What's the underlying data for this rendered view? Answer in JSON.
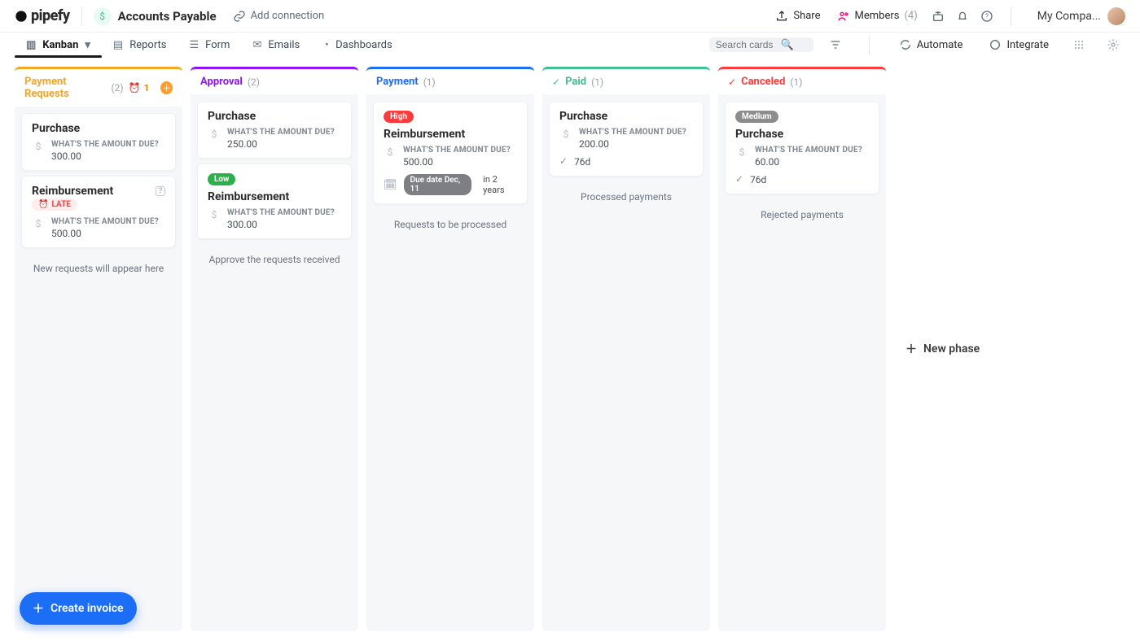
{
  "header": {
    "logo": "pipefy",
    "pipe_name": "Accounts Payable",
    "add_connection": "Add connection",
    "share": "Share",
    "members": "Members",
    "members_count": "(4)",
    "company": "My Compa...",
    "search_placeholder": "Search cards"
  },
  "tabs": {
    "kanban": "Kanban",
    "reports": "Reports",
    "form": "Form",
    "emails": "Emails",
    "dashboards": "Dashboards",
    "automate": "Automate",
    "integrate": "Integrate"
  },
  "columns": {
    "payment_requests": {
      "name": "Payment Requests",
      "count": "(2)",
      "alarm": "1",
      "footer": "New requests will appear here"
    },
    "approval": {
      "name": "Approval",
      "count": "(2)",
      "footer": "Approve the requests received"
    },
    "payment": {
      "name": "Payment",
      "count": "(1)",
      "footer": "Requests to be processed"
    },
    "paid": {
      "name": "Paid",
      "count": "(1)",
      "footer": "Processed payments"
    },
    "canceled": {
      "name": "Canceled",
      "count": "(1)",
      "footer": "Rejected payments"
    }
  },
  "labels": {
    "amount_due": "WHAT'S THE AMOUNT DUE?",
    "late": "LATE",
    "high": "High",
    "low": "Low",
    "medium": "Medium",
    "new_phase": "New phase",
    "create_invoice": "Create invoice"
  },
  "cards": {
    "pr1": {
      "title": "Purchase",
      "amount": "300.00"
    },
    "pr2": {
      "title": "Reimbursement",
      "amount": "500.00"
    },
    "ap1": {
      "title": "Purchase",
      "amount": "250.00"
    },
    "ap2": {
      "title": "Reimbursement",
      "amount": "300.00"
    },
    "pay1": {
      "title": "Reimbursement",
      "amount": "500.00",
      "due_chip": "Due date Dec, 11",
      "due_suffix": "in 2 years"
    },
    "paid1": {
      "title": "Purchase",
      "amount": "200.00",
      "age": "76d"
    },
    "can1": {
      "title": "Purchase",
      "amount": "60.00",
      "age": "76d"
    }
  },
  "colors": {
    "payment_requests": "#f5a623",
    "approval": "#9013fe",
    "payment": "#1d6ef7",
    "paid": "#3ec08f",
    "canceled": "#ff3b3b"
  }
}
